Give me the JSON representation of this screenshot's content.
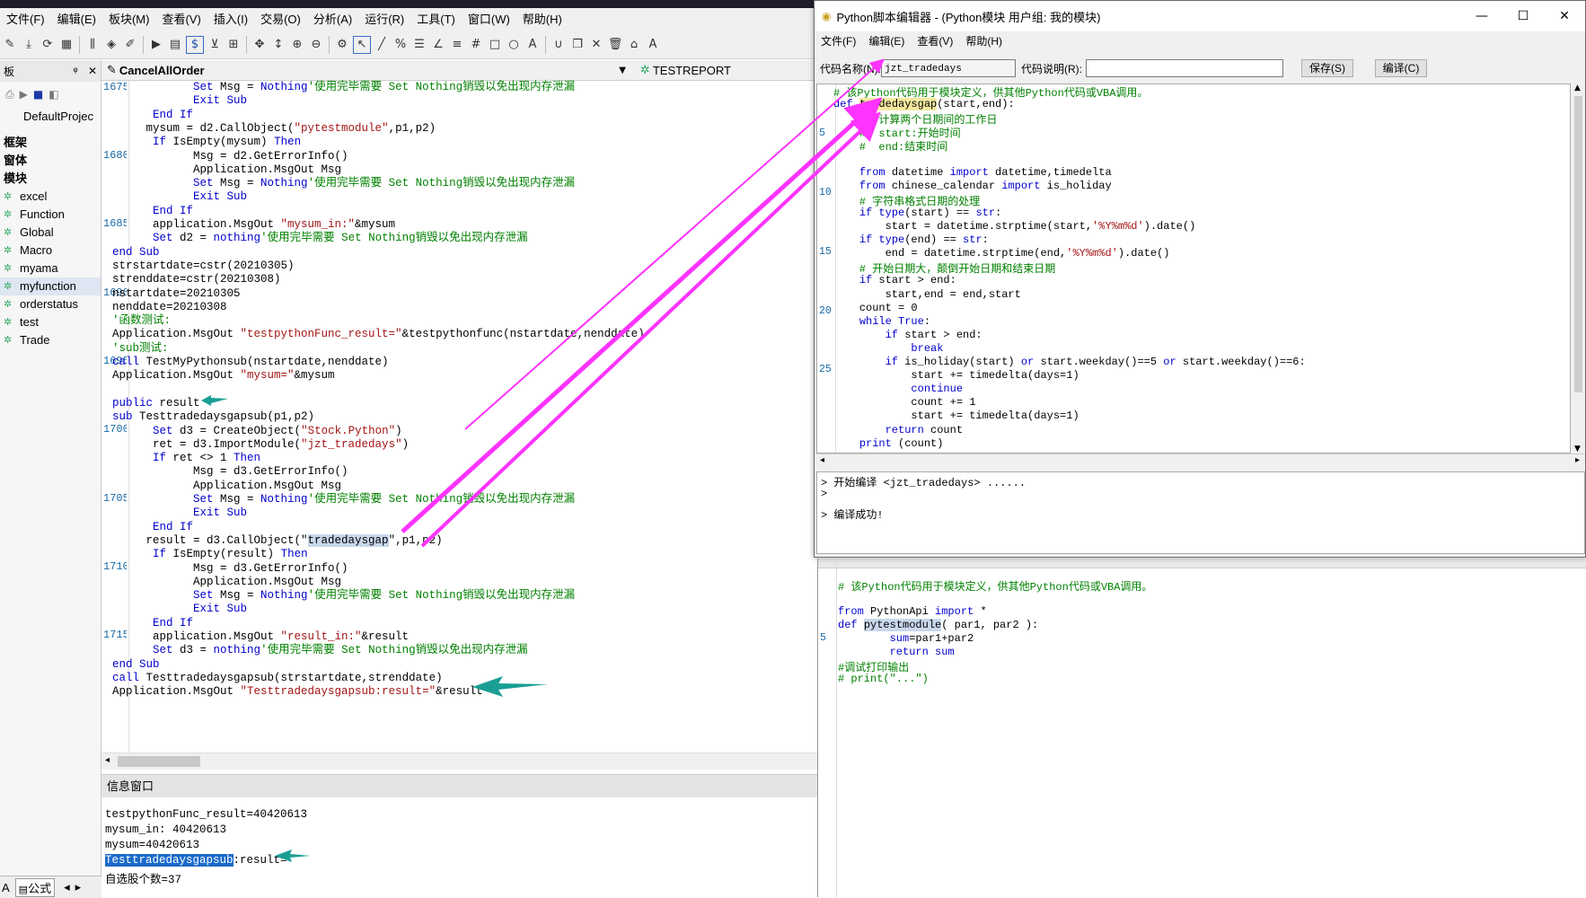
{
  "main_window": {
    "menu": [
      "文件(F)",
      "编辑(E)",
      "板块(M)",
      "查看(V)",
      "插入(I)",
      "交易(O)",
      "分析(A)",
      "运行(R)",
      "工具(T)",
      "窗口(W)",
      "帮助(H)"
    ]
  },
  "left_panel": {
    "header": "板",
    "pin": "ᵠ",
    "close": "✕",
    "project_tab": "DefaultProjec",
    "sections": [
      "框架",
      "窗体",
      "模块"
    ],
    "modules": [
      "excel",
      "Function",
      "Global",
      "Macro",
      "myama",
      "myfunction",
      "orderstatus",
      "test",
      "Trade"
    ],
    "bottom_tabs": [
      "A",
      "公式"
    ]
  },
  "editor_tabs": [
    {
      "label": "CancelAllOrder"
    },
    {
      "label": "TESTREPORT"
    }
  ],
  "code": {
    "line_numbers": [
      "1675",
      "1680",
      "1685",
      "1690",
      "1695",
      "1700",
      "1705",
      "1710",
      "1715"
    ],
    "lines": [
      [
        [
          "            ",
          ""
        ],
        [
          "Set",
          "kw"
        ],
        [
          " Msg = ",
          ""
        ],
        [
          "Nothing",
          "kw"
        ],
        [
          "'使用完毕需要 Set Nothing销毁以免出现内存泄漏",
          "cm"
        ]
      ],
      [
        [
          "            ",
          ""
        ],
        [
          "Exit Sub",
          "kw"
        ]
      ],
      [
        [
          "      ",
          ""
        ],
        [
          "End If",
          "kw"
        ]
      ],
      [
        [
          "     mysum = d2.CallObject(",
          ""
        ],
        [
          "\"pytestmodule\"",
          "st"
        ],
        [
          ",p1,p2)",
          ""
        ]
      ],
      [
        [
          "      ",
          ""
        ],
        [
          "If",
          "kw"
        ],
        [
          " IsEmpty(mysum) ",
          ""
        ],
        [
          "Then",
          "kw"
        ]
      ],
      [
        [
          "            Msg = d2.GetErrorInfo()",
          ""
        ]
      ],
      [
        [
          "            Application.MsgOut Msg",
          ""
        ]
      ],
      [
        [
          "            ",
          ""
        ],
        [
          "Set",
          "kw"
        ],
        [
          " Msg = ",
          ""
        ],
        [
          "Nothing",
          "kw"
        ],
        [
          "'使用完毕需要 Set Nothing销毁以免出现内存泄漏",
          "cm"
        ]
      ],
      [
        [
          "            ",
          ""
        ],
        [
          "Exit Sub",
          "kw"
        ]
      ],
      [
        [
          "      ",
          ""
        ],
        [
          "End If",
          "kw"
        ]
      ],
      [
        [
          "      application.MsgOut ",
          ""
        ],
        [
          "\"mysum_in:\"",
          "st"
        ],
        [
          "&mysum",
          ""
        ]
      ],
      [
        [
          "      ",
          ""
        ],
        [
          "Set",
          "kw"
        ],
        [
          " d2 = ",
          ""
        ],
        [
          "nothing",
          "kw"
        ],
        [
          "'使用完毕需要 Set Nothing销毁以免出现内存泄漏",
          "cm"
        ]
      ],
      [
        [
          "",
          ""
        ],
        [
          "end Sub",
          "kw"
        ]
      ],
      [
        [
          "strstartdate=cstr(20210305)",
          ""
        ]
      ],
      [
        [
          "strenddate=cstr(20210308)",
          ""
        ]
      ],
      [
        [
          "nstartdate=20210305",
          ""
        ]
      ],
      [
        [
          "nenddate=20210308",
          ""
        ]
      ],
      [
        [
          "",
          ""
        ],
        [
          "'函数测试:",
          "cm"
        ]
      ],
      [
        [
          "Application.MsgOut ",
          ""
        ],
        [
          "\"testpythonFunc_result=\"",
          "st"
        ],
        [
          "&testpythonfunc(nstartdate,nenddate)",
          ""
        ]
      ],
      [
        [
          "",
          ""
        ],
        [
          "'sub测试:",
          "cm"
        ]
      ],
      [
        [
          "",
          ""
        ],
        [
          "call",
          "kw"
        ],
        [
          " TestMyPythonsub(nstartdate,nenddate)",
          ""
        ]
      ],
      [
        [
          "Application.MsgOut ",
          ""
        ],
        [
          "\"mysum=\"",
          "st"
        ],
        [
          "&mysum",
          ""
        ]
      ],
      [
        [
          "",
          ""
        ]
      ],
      [
        [
          "",
          ""
        ],
        [
          "public",
          "kw"
        ],
        [
          " result",
          ""
        ]
      ],
      [
        [
          "",
          ""
        ],
        [
          "sub",
          "kw"
        ],
        [
          " Testtradedaysgapsub(p1,p2)",
          ""
        ]
      ],
      [
        [
          "      ",
          ""
        ],
        [
          "Set",
          "kw"
        ],
        [
          " d3 = CreateObject(",
          ""
        ],
        [
          "\"Stock.Python\"",
          "st"
        ],
        [
          ")",
          ""
        ]
      ],
      [
        [
          "      ret = d3.ImportModule(",
          ""
        ],
        [
          "\"jzt_tradedays\"",
          "st"
        ],
        [
          ")",
          ""
        ]
      ],
      [
        [
          "      ",
          ""
        ],
        [
          "If",
          "kw"
        ],
        [
          " ret <> 1 ",
          ""
        ],
        [
          "Then",
          "kw"
        ]
      ],
      [
        [
          "            Msg = d3.GetErrorInfo()",
          ""
        ]
      ],
      [
        [
          "            Application.MsgOut Msg",
          ""
        ]
      ],
      [
        [
          "            ",
          ""
        ],
        [
          "Set",
          "kw"
        ],
        [
          " Msg = ",
          ""
        ],
        [
          "Nothing",
          "kw"
        ],
        [
          "'使用完毕需要 Set Nothing销毁以免出现内存泄漏",
          "cm"
        ]
      ],
      [
        [
          "            ",
          ""
        ],
        [
          "Exit Sub",
          "kw"
        ]
      ],
      [
        [
          "      ",
          ""
        ],
        [
          "End If",
          "kw"
        ]
      ],
      [
        [
          "     result = d3.CallObject(\"",
          ""
        ],
        [
          "tradedaysgap",
          "hl"
        ],
        [
          "\",p1,p2)",
          ""
        ]
      ],
      [
        [
          "      ",
          ""
        ],
        [
          "If",
          "kw"
        ],
        [
          " IsEmpty(result) ",
          ""
        ],
        [
          "Then",
          "kw"
        ]
      ],
      [
        [
          "            Msg = d3.GetErrorInfo()",
          ""
        ]
      ],
      [
        [
          "            Application.MsgOut Msg",
          ""
        ]
      ],
      [
        [
          "            ",
          ""
        ],
        [
          "Set",
          "kw"
        ],
        [
          " Msg = ",
          ""
        ],
        [
          "Nothing",
          "kw"
        ],
        [
          "'使用完毕需要 Set Nothing销毁以免出现内存泄漏",
          "cm"
        ]
      ],
      [
        [
          "            ",
          ""
        ],
        [
          "Exit Sub",
          "kw"
        ]
      ],
      [
        [
          "      ",
          ""
        ],
        [
          "End If",
          "kw"
        ]
      ],
      [
        [
          "      application.MsgOut ",
          ""
        ],
        [
          "\"result_in:\"",
          "st"
        ],
        [
          "&result",
          ""
        ]
      ],
      [
        [
          "      ",
          ""
        ],
        [
          "Set",
          "kw"
        ],
        [
          " d3 = ",
          ""
        ],
        [
          "nothing",
          "kw"
        ],
        [
          "'使用完毕需要 Set Nothing销毁以免出现内存泄漏",
          "cm"
        ]
      ],
      [
        [
          "",
          ""
        ],
        [
          "end Sub",
          "kw"
        ]
      ],
      [
        [
          "",
          ""
        ],
        [
          "call",
          "kw"
        ],
        [
          " Testtradedaysgapsub(strstartdate,strenddate)",
          ""
        ]
      ],
      [
        [
          "Application.MsgOut ",
          ""
        ],
        [
          "\"Testtradedaysgapsub:result=\"",
          "st"
        ],
        [
          "&result",
          ""
        ]
      ]
    ]
  },
  "info_window": {
    "title": "信息窗口",
    "lines": [
      "testpythonFunc_result=40420613",
      "mysum_in: 40420613",
      "mysum=40420613",
      "",
      "自选股个数=37"
    ],
    "selected_text": "Testtradedaysgapsub",
    "selected_rest": ":result="
  },
  "py_editor": {
    "title": "Python脚本编辑器 - (Python模块 用户组: 我的模块)",
    "minimize": "—",
    "maximize": "☐",
    "close": "✕",
    "menu": [
      "文件(F)",
      "编辑(E)",
      "查看(V)",
      "帮助(H)"
    ],
    "code_name_label": "代码名称(N):",
    "code_name_value": "jzt_tradedays",
    "code_desc_label": "代码说明(R):",
    "code_desc_value": "",
    "save_button": "保存(S)",
    "compile_button": "编译(C)",
    "line_numbers": [
      "5",
      "10",
      "15",
      "20",
      "25"
    ],
    "lines": [
      [
        [
          "# 该Python代码用于模块定义，供其他Python代码或VBA调用。",
          "cm"
        ]
      ],
      [
        [
          "def",
          "kw"
        ],
        [
          " ",
          ""
        ],
        [
          "tradedaysgap",
          "hly"
        ],
        [
          "(start,end):",
          ""
        ]
      ],
      [
        [
          "    #  计算两个日期间的工作日",
          "cm"
        ]
      ],
      [
        [
          "    #  start:开始时间",
          "cm"
        ]
      ],
      [
        [
          "    #  end:结束时间",
          "cm"
        ]
      ],
      [
        [
          "",
          ""
        ]
      ],
      [
        [
          "    ",
          ""
        ],
        [
          "from",
          "kw"
        ],
        [
          " datetime ",
          ""
        ],
        [
          "import",
          "kw"
        ],
        [
          " datetime,timedelta",
          ""
        ]
      ],
      [
        [
          "    ",
          ""
        ],
        [
          "from",
          "kw"
        ],
        [
          " chinese_calendar ",
          ""
        ],
        [
          "import",
          "kw"
        ],
        [
          " is_holiday",
          ""
        ]
      ],
      [
        [
          "    # 字符串格式日期的处理",
          "cm"
        ]
      ],
      [
        [
          "    ",
          ""
        ],
        [
          "if",
          "kw"
        ],
        [
          " ",
          ""
        ],
        [
          "type",
          "kw"
        ],
        [
          "(start) == ",
          ""
        ],
        [
          "str",
          "kw"
        ],
        [
          ":",
          ""
        ]
      ],
      [
        [
          "        start = datetime.strptime(start,",
          ""
        ],
        [
          "'%Y%m%d'",
          "st"
        ],
        [
          ").date()",
          ""
        ]
      ],
      [
        [
          "    ",
          ""
        ],
        [
          "if",
          "kw"
        ],
        [
          " ",
          ""
        ],
        [
          "type",
          "kw"
        ],
        [
          "(end) == ",
          ""
        ],
        [
          "str",
          "kw"
        ],
        [
          ":",
          ""
        ]
      ],
      [
        [
          "        end = datetime.strptime(end,",
          ""
        ],
        [
          "'%Y%m%d'",
          "st"
        ],
        [
          ").date()",
          ""
        ]
      ],
      [
        [
          "    # 开始日期大，颠倒开始日期和结束日期",
          "cm"
        ]
      ],
      [
        [
          "    ",
          ""
        ],
        [
          "if",
          "kw"
        ],
        [
          " start > end:",
          ""
        ]
      ],
      [
        [
          "        start,end = end,start",
          ""
        ]
      ],
      [
        [
          "    count = 0",
          ""
        ]
      ],
      [
        [
          "    ",
          ""
        ],
        [
          "while",
          "kw"
        ],
        [
          " ",
          ""
        ],
        [
          "True",
          "kw"
        ],
        [
          ":",
          ""
        ]
      ],
      [
        [
          "        ",
          ""
        ],
        [
          "if",
          "kw"
        ],
        [
          " start > end:",
          ""
        ]
      ],
      [
        [
          "            ",
          ""
        ],
        [
          "break",
          "kw"
        ]
      ],
      [
        [
          "        ",
          ""
        ],
        [
          "if",
          "kw"
        ],
        [
          " is_holiday(start) ",
          ""
        ],
        [
          "or",
          "kw"
        ],
        [
          " start.weekday()==5 ",
          ""
        ],
        [
          "or",
          "kw"
        ],
        [
          " start.weekday()==6:",
          ""
        ]
      ],
      [
        [
          "            start += timedelta(days=1)",
          ""
        ]
      ],
      [
        [
          "            ",
          ""
        ],
        [
          "continue",
          "kw"
        ]
      ],
      [
        [
          "            count += 1",
          ""
        ]
      ],
      [
        [
          "            start += timedelta(days=1)",
          ""
        ]
      ],
      [
        [
          "        ",
          ""
        ],
        [
          "return",
          "kw"
        ],
        [
          " count",
          ""
        ]
      ],
      [
        [
          "    ",
          ""
        ],
        [
          "print",
          "kw"
        ],
        [
          " (count)",
          ""
        ]
      ]
    ],
    "output": [
      "> 开始编译 <jzt_tradedays> ......",
      ">",
      "",
      "> 编译成功!"
    ]
  },
  "bg_editor": {
    "line_numbers": [
      "5"
    ],
    "lines": [
      [
        [
          "# 该Python代码用于模块定义，供其他Python代码或VBA调用。",
          "cm"
        ]
      ],
      [
        [
          "",
          ""
        ]
      ],
      [
        [
          "from",
          "kw"
        ],
        [
          " PythonApi ",
          ""
        ],
        [
          "import",
          "kw"
        ],
        [
          " *",
          ""
        ]
      ],
      [
        [
          "def",
          "kw"
        ],
        [
          " ",
          ""
        ],
        [
          "pytestmodule",
          "hl"
        ],
        [
          "( par1, par2 ):",
          ""
        ]
      ],
      [
        [
          "        ",
          ""
        ],
        [
          "sum",
          "kw"
        ],
        [
          "=par1+par2",
          ""
        ]
      ],
      [
        [
          "        ",
          ""
        ],
        [
          "return",
          "kw"
        ],
        [
          " ",
          ""
        ],
        [
          "sum",
          "kw"
        ]
      ],
      [
        [
          "#调试打印输出",
          "cm"
        ]
      ],
      [
        [
          "# print(\"...\")",
          "cm"
        ]
      ]
    ]
  },
  "colors": {
    "annotation_arrow": "#ff33ff",
    "teal_arrow": "#1a9e94"
  }
}
